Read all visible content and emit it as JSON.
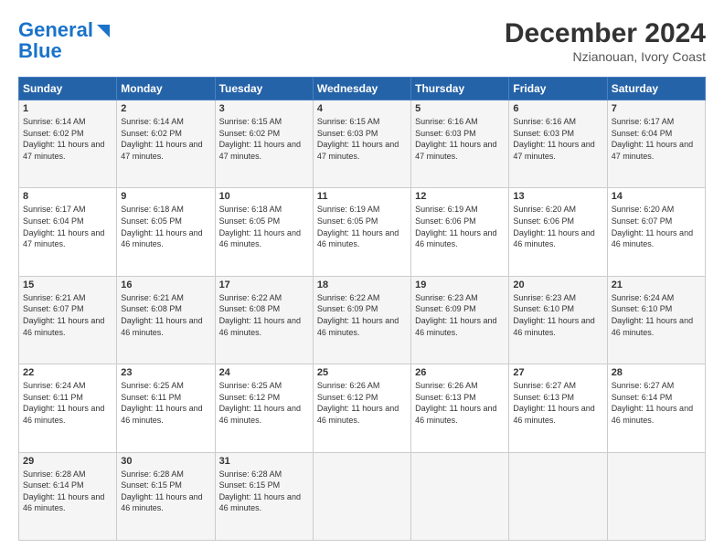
{
  "logo": {
    "line1": "General",
    "line2": "Blue"
  },
  "title": "December 2024",
  "subtitle": "Nzianouan, Ivory Coast",
  "headers": [
    "Sunday",
    "Monday",
    "Tuesday",
    "Wednesday",
    "Thursday",
    "Friday",
    "Saturday"
  ],
  "weeks": [
    [
      {
        "day": "1",
        "sunrise": "6:14 AM",
        "sunset": "6:02 PM",
        "daylight": "11 hours and 47 minutes."
      },
      {
        "day": "2",
        "sunrise": "6:14 AM",
        "sunset": "6:02 PM",
        "daylight": "11 hours and 47 minutes."
      },
      {
        "day": "3",
        "sunrise": "6:15 AM",
        "sunset": "6:02 PM",
        "daylight": "11 hours and 47 minutes."
      },
      {
        "day": "4",
        "sunrise": "6:15 AM",
        "sunset": "6:03 PM",
        "daylight": "11 hours and 47 minutes."
      },
      {
        "day": "5",
        "sunrise": "6:16 AM",
        "sunset": "6:03 PM",
        "daylight": "11 hours and 47 minutes."
      },
      {
        "day": "6",
        "sunrise": "6:16 AM",
        "sunset": "6:03 PM",
        "daylight": "11 hours and 47 minutes."
      },
      {
        "day": "7",
        "sunrise": "6:17 AM",
        "sunset": "6:04 PM",
        "daylight": "11 hours and 47 minutes."
      }
    ],
    [
      {
        "day": "8",
        "sunrise": "6:17 AM",
        "sunset": "6:04 PM",
        "daylight": "11 hours and 47 minutes."
      },
      {
        "day": "9",
        "sunrise": "6:18 AM",
        "sunset": "6:05 PM",
        "daylight": "11 hours and 46 minutes."
      },
      {
        "day": "10",
        "sunrise": "6:18 AM",
        "sunset": "6:05 PM",
        "daylight": "11 hours and 46 minutes."
      },
      {
        "day": "11",
        "sunrise": "6:19 AM",
        "sunset": "6:05 PM",
        "daylight": "11 hours and 46 minutes."
      },
      {
        "day": "12",
        "sunrise": "6:19 AM",
        "sunset": "6:06 PM",
        "daylight": "11 hours and 46 minutes."
      },
      {
        "day": "13",
        "sunrise": "6:20 AM",
        "sunset": "6:06 PM",
        "daylight": "11 hours and 46 minutes."
      },
      {
        "day": "14",
        "sunrise": "6:20 AM",
        "sunset": "6:07 PM",
        "daylight": "11 hours and 46 minutes."
      }
    ],
    [
      {
        "day": "15",
        "sunrise": "6:21 AM",
        "sunset": "6:07 PM",
        "daylight": "11 hours and 46 minutes."
      },
      {
        "day": "16",
        "sunrise": "6:21 AM",
        "sunset": "6:08 PM",
        "daylight": "11 hours and 46 minutes."
      },
      {
        "day": "17",
        "sunrise": "6:22 AM",
        "sunset": "6:08 PM",
        "daylight": "11 hours and 46 minutes."
      },
      {
        "day": "18",
        "sunrise": "6:22 AM",
        "sunset": "6:09 PM",
        "daylight": "11 hours and 46 minutes."
      },
      {
        "day": "19",
        "sunrise": "6:23 AM",
        "sunset": "6:09 PM",
        "daylight": "11 hours and 46 minutes."
      },
      {
        "day": "20",
        "sunrise": "6:23 AM",
        "sunset": "6:10 PM",
        "daylight": "11 hours and 46 minutes."
      },
      {
        "day": "21",
        "sunrise": "6:24 AM",
        "sunset": "6:10 PM",
        "daylight": "11 hours and 46 minutes."
      }
    ],
    [
      {
        "day": "22",
        "sunrise": "6:24 AM",
        "sunset": "6:11 PM",
        "daylight": "11 hours and 46 minutes."
      },
      {
        "day": "23",
        "sunrise": "6:25 AM",
        "sunset": "6:11 PM",
        "daylight": "11 hours and 46 minutes."
      },
      {
        "day": "24",
        "sunrise": "6:25 AM",
        "sunset": "6:12 PM",
        "daylight": "11 hours and 46 minutes."
      },
      {
        "day": "25",
        "sunrise": "6:26 AM",
        "sunset": "6:12 PM",
        "daylight": "11 hours and 46 minutes."
      },
      {
        "day": "26",
        "sunrise": "6:26 AM",
        "sunset": "6:13 PM",
        "daylight": "11 hours and 46 minutes."
      },
      {
        "day": "27",
        "sunrise": "6:27 AM",
        "sunset": "6:13 PM",
        "daylight": "11 hours and 46 minutes."
      },
      {
        "day": "28",
        "sunrise": "6:27 AM",
        "sunset": "6:14 PM",
        "daylight": "11 hours and 46 minutes."
      }
    ],
    [
      {
        "day": "29",
        "sunrise": "6:28 AM",
        "sunset": "6:14 PM",
        "daylight": "11 hours and 46 minutes."
      },
      {
        "day": "30",
        "sunrise": "6:28 AM",
        "sunset": "6:15 PM",
        "daylight": "11 hours and 46 minutes."
      },
      {
        "day": "31",
        "sunrise": "6:28 AM",
        "sunset": "6:15 PM",
        "daylight": "11 hours and 46 minutes."
      },
      null,
      null,
      null,
      null
    ]
  ]
}
